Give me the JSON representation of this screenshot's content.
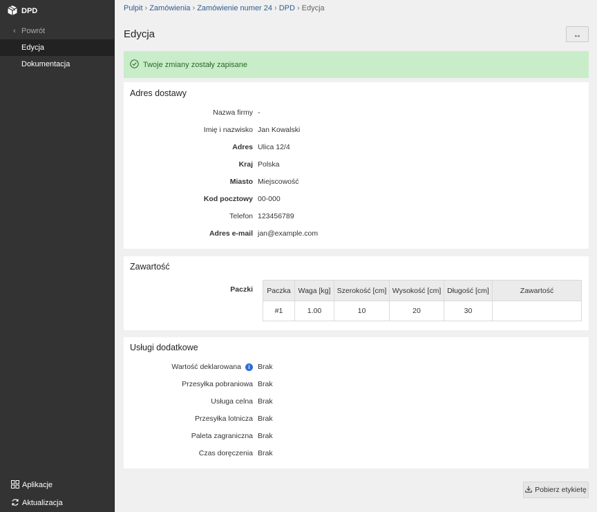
{
  "sidebar": {
    "brand": "DPD",
    "back": "Powrót",
    "items": [
      "Edycja",
      "Dokumentacja"
    ],
    "bottom": [
      "Aplikacje",
      "Aktualizacja"
    ]
  },
  "breadcrumb": [
    "Pulpit",
    "Zamówienia",
    "Zamówienie numer 24",
    "DPD",
    "Edycja"
  ],
  "page": {
    "title": "Edycja",
    "toggle": "↔"
  },
  "alert": "Twoje zmiany zostały zapisane",
  "address": {
    "title": "Adres dostawy",
    "rows": [
      {
        "label": "Nazwa firmy",
        "value": "-"
      },
      {
        "label": "Imię i nazwisko",
        "value": "Jan Kowalski"
      },
      {
        "label": "Adres",
        "value": "Ulica 12/4"
      },
      {
        "label": "Kraj",
        "value": "Polska"
      },
      {
        "label": "Miasto",
        "value": "Miejscowość"
      },
      {
        "label": "Kod pocztowy",
        "value": "00-000"
      },
      {
        "label": "Telefon",
        "value": "123456789"
      },
      {
        "label": "Adres e-mail",
        "value": "jan@example.com"
      }
    ]
  },
  "content": {
    "title": "Zawartość",
    "label": "Paczki",
    "headers": [
      "Paczka",
      "Waga [kg]",
      "Szerokość [cm]",
      "Wysokość [cm]",
      "Długość [cm]",
      "Zawartość"
    ],
    "rows": [
      [
        "#1",
        "1.00",
        "10",
        "20",
        "30",
        ""
      ]
    ]
  },
  "services": {
    "title": "Usługi dodatkowe",
    "rows": [
      {
        "label": "Wartość deklarowana",
        "value": "Brak"
      },
      {
        "label": "Przesyłka pobraniowa",
        "value": "Brak"
      },
      {
        "label": "Usługa celna",
        "value": "Brak"
      },
      {
        "label": "Przesyłka lotnicza",
        "value": "Brak"
      },
      {
        "label": "Paleta zagraniczna",
        "value": "Brak"
      },
      {
        "label": "Czas doręczenia",
        "value": "Brak"
      }
    ]
  },
  "download_label": "Pobierz etykietę"
}
